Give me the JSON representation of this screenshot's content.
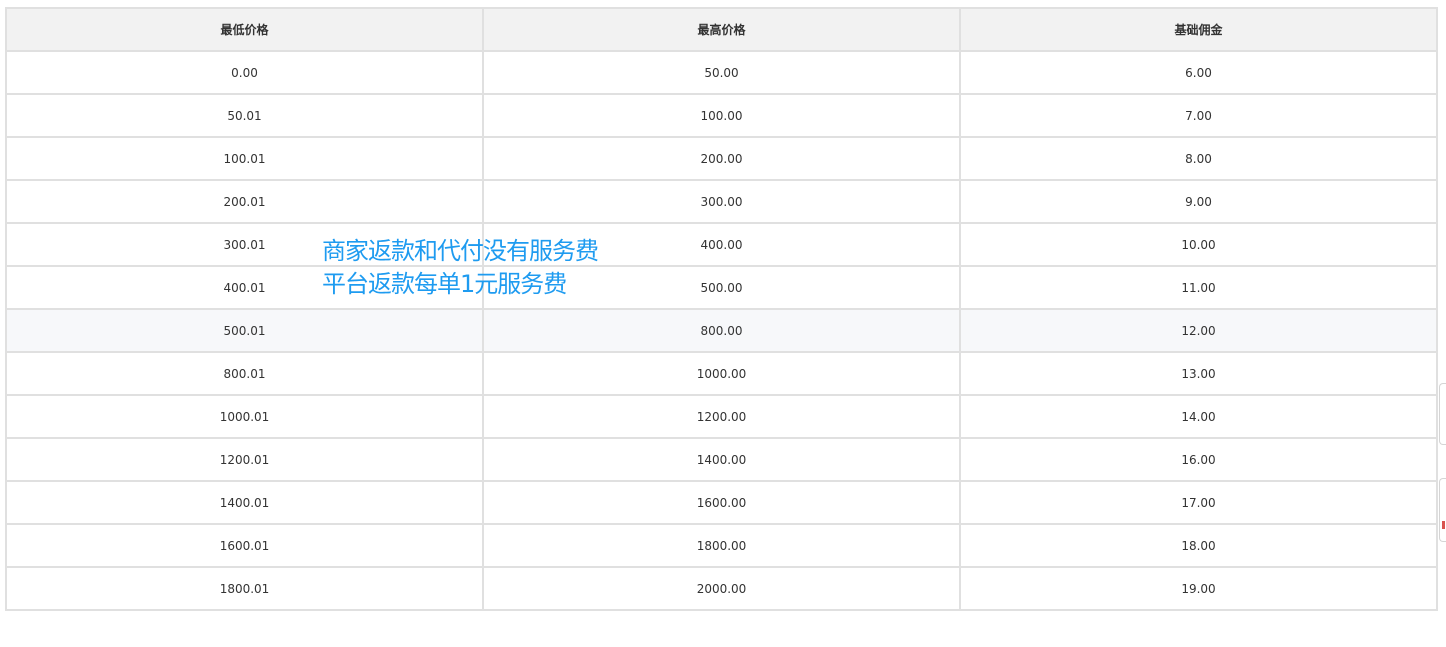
{
  "table": {
    "headers": [
      "最低价格",
      "最高价格",
      "基础佣金"
    ],
    "rows": [
      [
        "0.00",
        "50.00",
        "6.00"
      ],
      [
        "50.01",
        "100.00",
        "7.00"
      ],
      [
        "100.01",
        "200.00",
        "8.00"
      ],
      [
        "200.01",
        "300.00",
        "9.00"
      ],
      [
        "300.01",
        "400.00",
        "10.00"
      ],
      [
        "400.01",
        "500.00",
        "11.00"
      ],
      [
        "500.01",
        "800.00",
        "12.00"
      ],
      [
        "800.01",
        "1000.00",
        "13.00"
      ],
      [
        "1000.01",
        "1200.00",
        "14.00"
      ],
      [
        "1200.01",
        "1400.00",
        "16.00"
      ],
      [
        "1400.01",
        "1600.00",
        "17.00"
      ],
      [
        "1600.01",
        "1800.00",
        "18.00"
      ],
      [
        "1800.01",
        "2000.00",
        "19.00"
      ]
    ],
    "highlighted_row_index": 6
  },
  "annotation": {
    "line1": "商家返款和代付没有服务费",
    "line2": "平台返款每单1元服务费",
    "color": "#1e9bf0"
  }
}
